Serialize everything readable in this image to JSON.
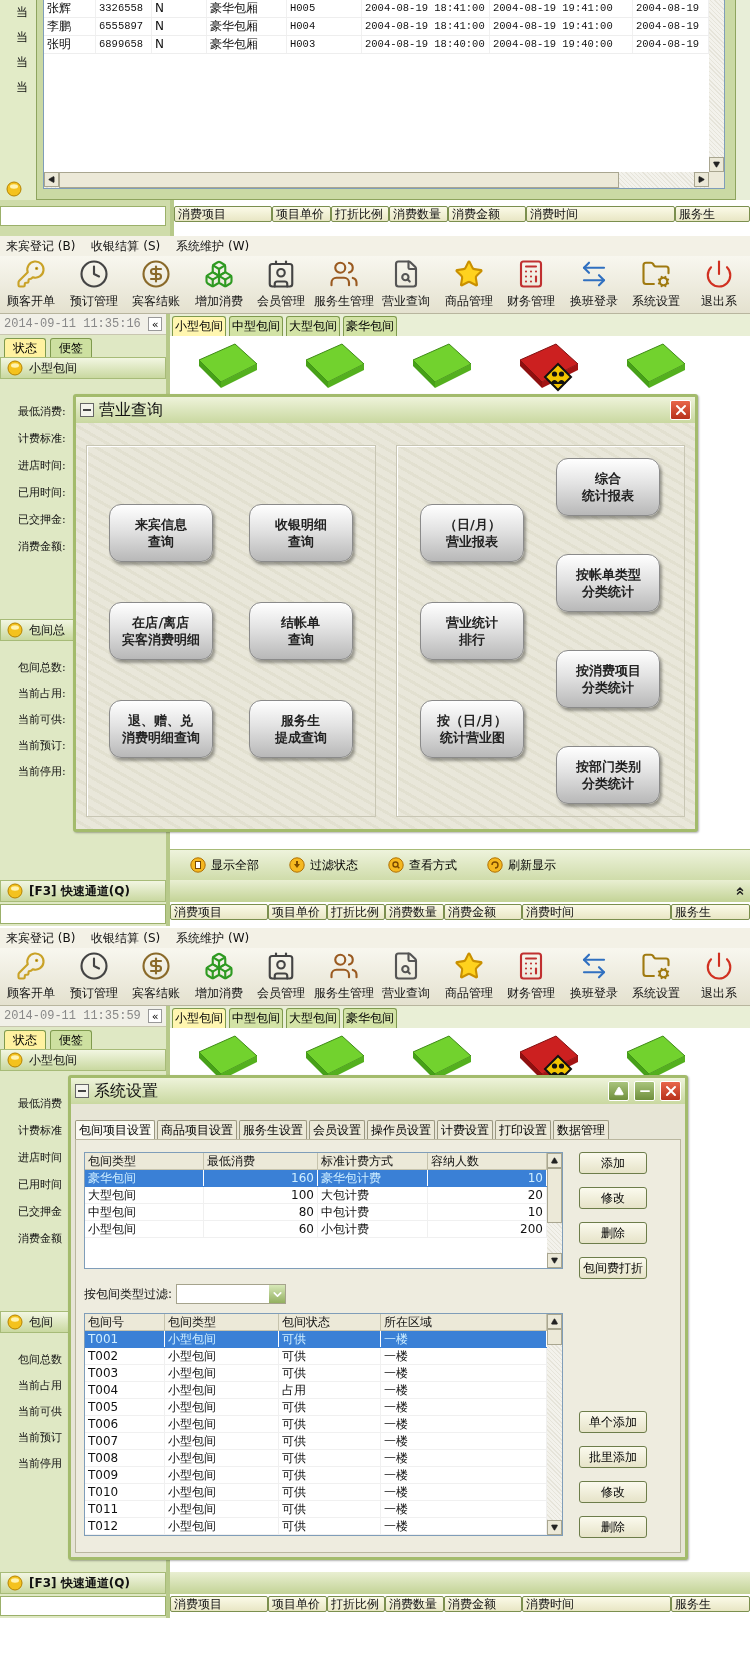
{
  "top_fragment": {
    "side_labels": [
      "当",
      "当",
      "当",
      "当"
    ],
    "records": [
      {
        "cells": [
          "张辉",
          "3326558",
          "N",
          "豪华包厢",
          "H005",
          "2004-08-19 18:41:00",
          "2004-08-19 19:41:00",
          "2004-08-19"
        ]
      },
      {
        "cells": [
          "李鹏",
          "6555897",
          "N",
          "豪华包厢",
          "H004",
          "2004-08-19 18:41:00",
          "2004-08-19 19:41:00",
          "2004-08-19"
        ]
      },
      {
        "cells": [
          "张明",
          "6899658",
          "N",
          "豪华包厢",
          "H003",
          "2004-08-19 18:40:00",
          "2004-08-19 19:40:00",
          "2004-08-19"
        ]
      }
    ],
    "consumption_columns": [
      "消费项目",
      "项目单价",
      "打折比例",
      "消费数量",
      "消费金额",
      "消费时间",
      "服务生"
    ]
  },
  "screens": [
    {
      "kind": "query",
      "menu": [
        "来宾登记 (B)",
        "收银结算 (S)",
        "系统维护 (W)"
      ],
      "toolbar": [
        "顾客开单",
        "预订管理",
        "宾客结账",
        "增加消费",
        "会员管理",
        "服务生管理",
        "营业查询",
        "商品管理",
        "财务管理",
        "换班登录",
        "系统设置",
        "退出系"
      ],
      "clock": "2014-09-11 11:35:16",
      "collapse": "«",
      "room_tabs": [
        {
          "label": "小型包间",
          "selected": true
        },
        {
          "label": "中型包间",
          "selected": false
        },
        {
          "label": "大型包间",
          "selected": false
        },
        {
          "label": "豪华包间",
          "selected": false
        }
      ],
      "side_tabs": [
        {
          "label": "状态",
          "selected": true
        },
        {
          "label": "便签",
          "selected": false
        }
      ],
      "room_group": {
        "title": "小型包间",
        "fields": [
          "最低消费:",
          "计费标准:",
          "进店时间:",
          "已用时间:",
          "已交押金:",
          "消费金额:"
        ]
      },
      "summary_group": {
        "title": "包间总",
        "fields": [
          "包间总数:",
          "当前占用:",
          "当前可供:",
          "当前预订:",
          "当前停用:"
        ]
      },
      "rooms": [
        {
          "occupied": false
        },
        {
          "occupied": false
        },
        {
          "occupied": false
        },
        {
          "occupied": true
        },
        {
          "occupied": false
        }
      ],
      "actions": [
        "显示全部",
        "过滤状态",
        "查看方式",
        "刷新显示"
      ],
      "quick_access": "[F3] 快速通道(Q)",
      "consumption_columns": [
        "消费项目",
        "项目单价",
        "打折比例",
        "消费数量",
        "消费金额",
        "消费时间",
        "服务生"
      ],
      "dialog": {
        "title": "营业查询",
        "left_buttons": [
          [
            "来宾信息",
            "查询"
          ],
          [
            "收银明细",
            "查询"
          ],
          [
            "在店/离店",
            "宾客消费明细"
          ],
          [
            "结帐单",
            "查询"
          ],
          [
            "退、赠、兑",
            "消费明细查询"
          ],
          [
            "服务生",
            "提成查询"
          ]
        ],
        "right_columns": [
          [
            [
              "（日/月）",
              "营业报表"
            ],
            [
              "营业统计",
              "排行"
            ],
            [
              "按（日/月）",
              "统计营业图"
            ]
          ],
          [
            [
              "综合",
              "统计报表"
            ],
            [
              "按帐单类型",
              "分类统计"
            ],
            [
              "按消费项目",
              "分类统计"
            ],
            [
              "按部门类别",
              "分类统计"
            ]
          ]
        ]
      }
    },
    {
      "kind": "settings",
      "menu": [
        "来宾登记 (B)",
        "收银结算 (S)",
        "系统维护 (W)"
      ],
      "toolbar": [
        "顾客开单",
        "预订管理",
        "宾客结账",
        "增加消费",
        "会员管理",
        "服务生管理",
        "营业查询",
        "商品管理",
        "财务管理",
        "换班登录",
        "系统设置",
        "退出系"
      ],
      "clock": "2014-09-11 11:35:59",
      "collapse": "«",
      "room_tabs": [
        {
          "label": "小型包间",
          "selected": true
        },
        {
          "label": "中型包间",
          "selected": false
        },
        {
          "label": "大型包间",
          "selected": false
        },
        {
          "label": "豪华包间",
          "selected": false
        }
      ],
      "side_tabs": [
        {
          "label": "状态",
          "selected": true
        },
        {
          "label": "便签",
          "selected": false
        }
      ],
      "room_group": {
        "title": "小型包间",
        "fields": [
          "最低消费",
          "计费标准",
          "进店时间",
          "已用时间",
          "已交押金",
          "消费金额"
        ]
      },
      "summary_group": {
        "title": "包间",
        "fields": [
          "包间总数",
          "当前占用",
          "当前可供",
          "当前预订",
          "当前停用"
        ]
      },
      "rooms": [
        {
          "occupied": false
        },
        {
          "occupied": false
        },
        {
          "occupied": false
        },
        {
          "occupied": true
        },
        {
          "occupied": false
        }
      ],
      "quick_access": "[F3] 快速通道(Q)",
      "consumption_columns": [
        "消费项目",
        "项目单价",
        "打折比例",
        "消费数量",
        "消费金额",
        "消费时间",
        "服务生"
      ],
      "dialog": {
        "title": "系统设置",
        "tabs": [
          {
            "label": "包间项目设置",
            "selected": true
          },
          {
            "label": "商品项目设置",
            "selected": false
          },
          {
            "label": "服务生设置",
            "selected": false
          },
          {
            "label": "会员设置",
            "selected": false
          },
          {
            "label": "操作员设置",
            "selected": false
          },
          {
            "label": "计费设置",
            "selected": false
          },
          {
            "label": "打印设置",
            "selected": false
          },
          {
            "label": "数据管理",
            "selected": false
          }
        ],
        "type_table": {
          "columns": [
            "包间类型",
            "最低消费",
            "标准计费方式",
            "容纳人数"
          ],
          "rows": [
            {
              "cells": [
                "豪华包间",
                "160",
                "豪华包计费",
                "10"
              ],
              "selected": true
            },
            {
              "cells": [
                "大型包间",
                "100",
                "大包计费",
                "20"
              ],
              "selected": false
            },
            {
              "cells": [
                "中型包间",
                "80",
                "中包计费",
                "10"
              ],
              "selected": false
            },
            {
              "cells": [
                "小型包间",
                "60",
                "小包计费",
                "200"
              ],
              "selected": false
            }
          ]
        },
        "type_buttons": [
          "添加",
          "修改",
          "删除",
          "包间费打折"
        ],
        "filter_label": "按包间类型过滤:",
        "room_table": {
          "columns": [
            "包间号",
            "包间类型",
            "包间状态",
            "所在区域"
          ],
          "rows": [
            {
              "cells": [
                "T001",
                "小型包间",
                "可供",
                "一楼"
              ],
              "selected": true
            },
            {
              "cells": [
                "T002",
                "小型包间",
                "可供",
                "一楼"
              ],
              "selected": false
            },
            {
              "cells": [
                "T003",
                "小型包间",
                "可供",
                "一楼"
              ],
              "selected": false
            },
            {
              "cells": [
                "T004",
                "小型包间",
                "占用",
                "一楼"
              ],
              "selected": false
            },
            {
              "cells": [
                "T005",
                "小型包间",
                "可供",
                "一楼"
              ],
              "selected": false
            },
            {
              "cells": [
                "T006",
                "小型包间",
                "可供",
                "一楼"
              ],
              "selected": false
            },
            {
              "cells": [
                "T007",
                "小型包间",
                "可供",
                "一楼"
              ],
              "selected": false
            },
            {
              "cells": [
                "T008",
                "小型包间",
                "可供",
                "一楼"
              ],
              "selected": false
            },
            {
              "cells": [
                "T009",
                "小型包间",
                "可供",
                "一楼"
              ],
              "selected": false
            },
            {
              "cells": [
                "T010",
                "小型包间",
                "可供",
                "一楼"
              ],
              "selected": false
            },
            {
              "cells": [
                "T011",
                "小型包间",
                "可供",
                "一楼"
              ],
              "selected": false
            },
            {
              "cells": [
                "T012",
                "小型包间",
                "可供",
                "一楼"
              ],
              "selected": false
            }
          ]
        },
        "room_buttons": [
          "单个添加",
          "批里添加",
          "修改",
          "删除"
        ]
      }
    }
  ]
}
